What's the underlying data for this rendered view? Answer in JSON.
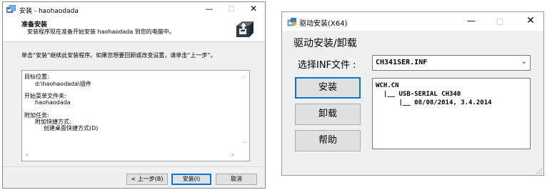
{
  "installer": {
    "title": "安装 - haohaodada",
    "controls": {
      "minimize": "—",
      "maximize": "□",
      "close": "✕"
    },
    "header": {
      "title": "准备安装",
      "subtitle": "安装程序现在准备开始安装 haohaodada 到您的电脑中。"
    },
    "intro": "单击“安装”继续此安装程序。如果您想要回顾或改变设置，请单击“上一步”。",
    "details": {
      "dest_label": "目标位置:",
      "dest_value": "d:\\haohaodada\\插件",
      "start_menu_label": "开始菜单文件夹:",
      "start_menu_value": "haohaodada",
      "tasks_label": "附加任务:",
      "tasks_group": "附加快捷方式:",
      "tasks_item": "创建桌面快捷方式(D)"
    },
    "buttons": {
      "back": "< 上一步(B)",
      "install": "安装(I)",
      "cancel": "取消"
    }
  },
  "driver": {
    "title": "驱动安装(X64)",
    "controls": {
      "minimize": "—",
      "maximize": "□",
      "close": "✕"
    },
    "group_label": "驱动安装/卸载",
    "inf_label": "选择INF文件 :",
    "inf_selected": "CH341SER.INF",
    "buttons": {
      "install": "安装",
      "uninstall": "卸载",
      "help": "帮助"
    },
    "info_text": "WCH.CN\n  |__ USB-SERIAL CH340\n      |__ 08/08/2014, 3.4.2014"
  },
  "colors": {
    "accent": "#0078d7",
    "window_bg": "#f0f0f0",
    "border": "#adadad"
  }
}
